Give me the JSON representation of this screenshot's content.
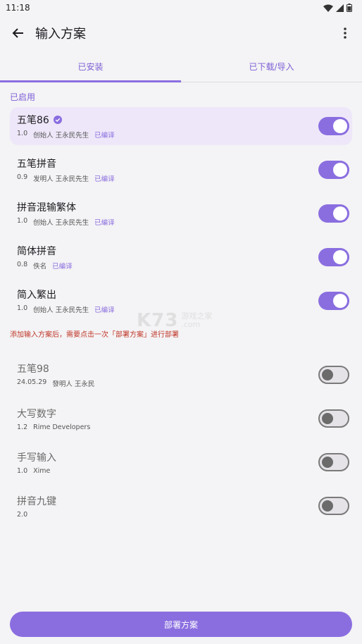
{
  "status": {
    "time": "11:18"
  },
  "app_bar": {
    "title": "输入方案"
  },
  "tabs": [
    {
      "label": "已安装"
    },
    {
      "label": "已下载/导入"
    }
  ],
  "enabled_section": {
    "label": "已启用"
  },
  "enabled_items": [
    {
      "name": "五笔86",
      "version": "1.0",
      "author": "创始人 王永民先生",
      "status": "已编译",
      "verified": true
    },
    {
      "name": "五笔拼音",
      "version": "0.9",
      "author": "发明人 王永民先生",
      "status": "已编译"
    },
    {
      "name": "拼音混输繁体",
      "version": "1.0",
      "author": "创始人 王永民先生",
      "status": "已编译"
    },
    {
      "name": "简体拼音",
      "version": "0.8",
      "author": "佚名",
      "status": "已编译"
    },
    {
      "name": "简入繁出",
      "version": "1.0",
      "author": "创始人 王永民先生",
      "status": "已编译"
    }
  ],
  "notice": "添加输入方案后，需要点击一次「部署方案」进行部署",
  "watermark": {
    "main": "K73",
    "sub1": "游戏之家",
    "sub2": ".com"
  },
  "disabled_items": [
    {
      "name": "五笔98",
      "version": "24.05.29",
      "author": "發明人 王永民"
    },
    {
      "name": "大写数字",
      "version": "1.2",
      "author": "Rime Developers"
    },
    {
      "name": "手写输入",
      "version": "1.0",
      "author": "Xime"
    },
    {
      "name": "拼音九键",
      "version": "2.0",
      "author": ""
    }
  ],
  "deploy_button": {
    "label": "部署方案"
  },
  "colors": {
    "accent": "#8a6ee0",
    "notice": "#c0392b",
    "selected_bg": "#eee7f9"
  }
}
